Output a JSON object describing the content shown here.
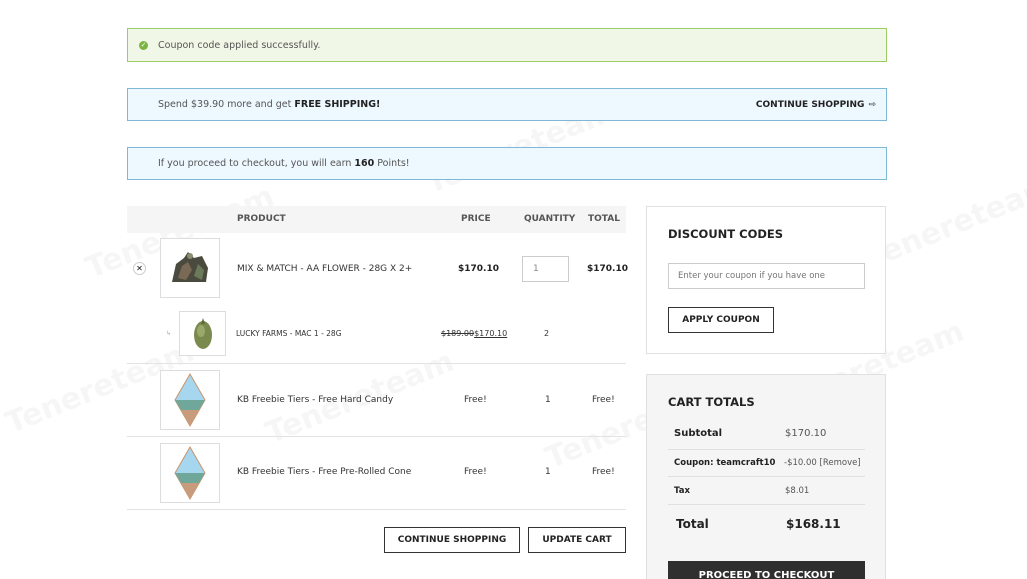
{
  "notices": {
    "success": "Coupon code applied successfully.",
    "shipping_prefix": "Spend $39.90 more and get ",
    "shipping_bold": "FREE SHIPPING!",
    "continue_label": "CONTINUE SHOPPING",
    "points_prefix": "If you proceed to checkout, you will earn ",
    "points_value": "160",
    "points_suffix": " Points!"
  },
  "cart": {
    "columns": {
      "product": "PRODUCT",
      "price": "PRICE",
      "quantity": "QUANTITY",
      "total": "TOTAL"
    },
    "items": [
      {
        "name": "MIX & MATCH - AA FLOWER - 28G X 2+",
        "price": "$170.10",
        "quantity": "1",
        "total": "$170.10"
      },
      {
        "name": "LUCKY FARMS - MAC 1 - 28G",
        "old_price": "$189.00",
        "price": "$170.10",
        "quantity": "2"
      },
      {
        "name": "KB Freebie Tiers - Free Hard Candy",
        "price": "Free!",
        "quantity": "1",
        "total": "Free!"
      },
      {
        "name": "KB Freebie Tiers - Free Pre-Rolled Cone",
        "price": "Free!",
        "quantity": "1",
        "total": "Free!"
      }
    ],
    "continue_label": "CONTINUE SHOPPING",
    "update_label": "UPDATE CART"
  },
  "discount": {
    "title": "DISCOUNT CODES",
    "placeholder": "Enter your coupon if you have one",
    "apply_label": "APPLY COUPON"
  },
  "totals": {
    "title": "CART TOTALS",
    "subtotal_label": "Subtotal",
    "subtotal_value": "$170.10",
    "coupon_label": "Coupon: teamcraft10",
    "coupon_value": "-$10.00",
    "coupon_remove": "[Remove]",
    "tax_label": "Tax",
    "tax_value": "$8.01",
    "total_label": "Total",
    "total_value": "$168.11",
    "checkout_label": "PROCEED TO CHECKOUT"
  },
  "watermark": "Tenereteam",
  "colors": {
    "success_bg": "#f0f7e6",
    "success_border": "#9ccc65",
    "info_bg": "#eef8ff",
    "info_border": "#7fb8d6",
    "checkout_bg": "#2f2f2f"
  }
}
